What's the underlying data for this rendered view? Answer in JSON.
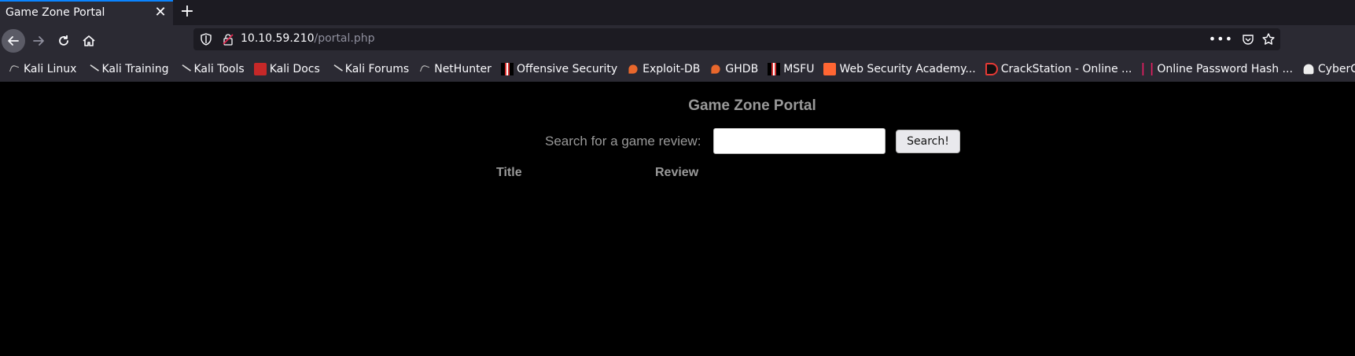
{
  "tab": {
    "title": "Game Zone Portal",
    "close_glyph": "✕"
  },
  "newtab_glyph": "+",
  "url": {
    "host": "10.10.59.210",
    "path": "/portal.php",
    "more_glyph": "•••"
  },
  "bookmarks": [
    {
      "label": "Kali Linux",
      "icon": "kali-dragon-icon"
    },
    {
      "label": "Kali Training",
      "icon": "kali-dragon-icon"
    },
    {
      "label": "Kali Tools",
      "icon": "kali-dragon-icon"
    },
    {
      "label": "Kali Docs",
      "icon": "kali-docs-icon"
    },
    {
      "label": "Kali Forums",
      "icon": "kali-dragon-icon"
    },
    {
      "label": "NetHunter",
      "icon": "kali-dragon-icon"
    },
    {
      "label": "Offensive Security",
      "icon": "offsec-icon"
    },
    {
      "label": "Exploit-DB",
      "icon": "exploitdb-icon"
    },
    {
      "label": "GHDB",
      "icon": "exploitdb-icon"
    },
    {
      "label": "MSFU",
      "icon": "offsec-icon"
    },
    {
      "label": "Web Security Academy...",
      "icon": "portswigger-icon"
    },
    {
      "label": "CrackStation - Online ...",
      "icon": "crackstation-icon"
    },
    {
      "label": "Online Password Hash ...",
      "icon": "hash-icon"
    },
    {
      "label": "CyberChef",
      "icon": "cyberchef-icon"
    }
  ],
  "page": {
    "title": "Game Zone Portal",
    "search_label": "Search for a game review:",
    "search_value": "",
    "search_button": "Search!",
    "columns": [
      "Title",
      "Review"
    ]
  },
  "colors": {
    "accent": "#0a84ff",
    "chrome": "#2b2a33",
    "page_bg": "#000000",
    "page_text": "#999999"
  }
}
